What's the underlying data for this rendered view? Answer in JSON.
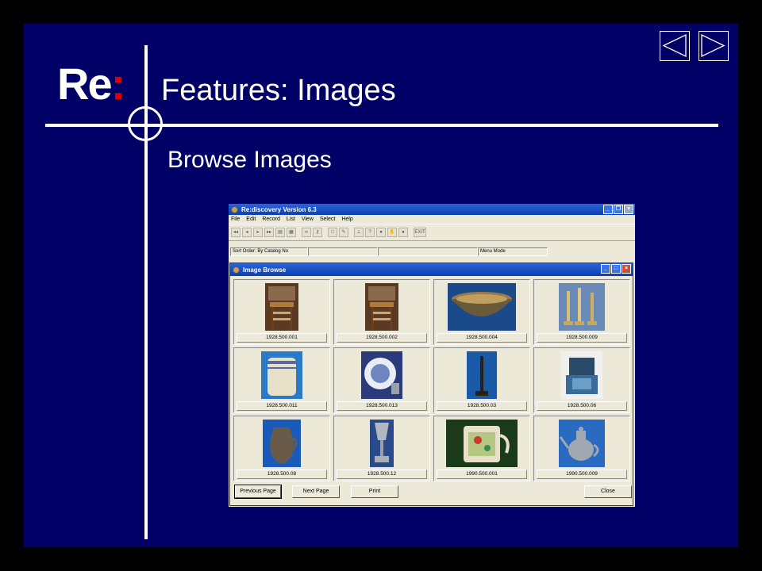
{
  "slide": {
    "logo": {
      "text": "Re",
      "colon": ":"
    },
    "title": "Features: Images",
    "subtitle": "Browse Images",
    "nav": {
      "prev_icon": "triangle-left-icon",
      "next_icon": "triangle-right-icon"
    }
  },
  "app": {
    "title": "Re:discovery Version 6.3",
    "menu": [
      "File",
      "Edit",
      "Record",
      "List",
      "View",
      "Select",
      "Help"
    ],
    "toolbar": {
      "exit_label": "EXIT"
    },
    "status": {
      "sort_order": "Sort Order: By Catalog No",
      "mode": "Menu Mode"
    }
  },
  "browse": {
    "title": "Image Browse",
    "images": [
      {
        "caption": "1928.500.001",
        "icon": "chair-photo"
      },
      {
        "caption": "1928.500.002",
        "icon": "chair-photo"
      },
      {
        "caption": "1928.500.004",
        "icon": "bowl-photo"
      },
      {
        "caption": "1928.500.009",
        "icon": "candlesticks-photo"
      },
      {
        "caption": "1928.500.011",
        "icon": "crock-photo"
      },
      {
        "caption": "1928.500.013",
        "icon": "plate-photo"
      },
      {
        "caption": "1928.500.03",
        "icon": "candlestick-photo"
      },
      {
        "caption": "1928.500.06",
        "icon": "box-photo"
      },
      {
        "caption": "1928.500.08",
        "icon": "jug-photo"
      },
      {
        "caption": "1928.500.12",
        "icon": "chalice-photo"
      },
      {
        "caption": "1990.500.001",
        "icon": "teapot-photo"
      },
      {
        "caption": "1990.500.009",
        "icon": "teapot-photo"
      }
    ],
    "buttons": {
      "previous": "Previous Page",
      "next": "Next Page",
      "print": "Print",
      "close": "Close"
    }
  },
  "colors": {
    "slide_bg": "#000066",
    "accent_red": "#e00000",
    "xp_blue": "#0a3fb0"
  }
}
